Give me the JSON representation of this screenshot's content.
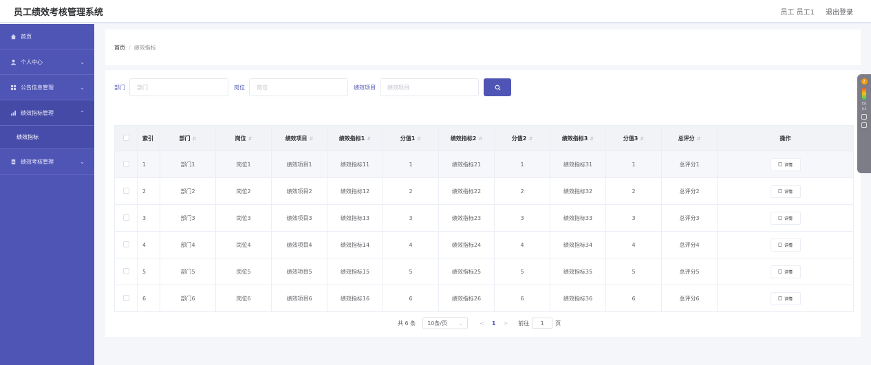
{
  "header": {
    "title": "员工绩效考核管理系统",
    "user": "员工 员工1",
    "logout": "退出登录"
  },
  "sidebar": {
    "items": [
      {
        "label": "首页",
        "icon": "home-icon"
      },
      {
        "label": "个人中心",
        "icon": "user-icon"
      },
      {
        "label": "公告信息管理",
        "icon": "grid-icon"
      },
      {
        "label": "绩效指标管理",
        "icon": "chart-icon",
        "expanded": true,
        "children": [
          {
            "label": "绩效指标"
          }
        ]
      },
      {
        "label": "绩效考核管理",
        "icon": "document-icon"
      }
    ]
  },
  "breadcrumb": {
    "home": "首页",
    "separator": "/",
    "current": "绩效指标"
  },
  "search": {
    "dept_label": "部门",
    "dept_placeholder": "部门",
    "post_label": "岗位",
    "post_placeholder": "岗位",
    "project_label": "绩效项目",
    "project_placeholder": "绩效项目"
  },
  "table": {
    "headers": [
      "索引",
      "部门",
      "岗位",
      "绩效项目",
      "绩效指标1",
      "分值1",
      "绩效指标2",
      "分值2",
      "绩效指标3",
      "分值3",
      "总评分",
      "操作"
    ],
    "detail_label": "详情",
    "rows": [
      [
        "1",
        "部门1",
        "岗位1",
        "绩效项目1",
        "绩效指标11",
        "1",
        "绩效指标21",
        "1",
        "绩效指标31",
        "1",
        "总评分1"
      ],
      [
        "2",
        "部门2",
        "岗位2",
        "绩效项目2",
        "绩效指标12",
        "2",
        "绩效指标22",
        "2",
        "绩效指标32",
        "2",
        "总评分2"
      ],
      [
        "3",
        "部门3",
        "岗位3",
        "绩效项目3",
        "绩效指标13",
        "3",
        "绩效指标23",
        "3",
        "绩效指标33",
        "3",
        "总评分3"
      ],
      [
        "4",
        "部门4",
        "岗位4",
        "绩效项目4",
        "绩效指标14",
        "4",
        "绩效指标24",
        "4",
        "绩效指标34",
        "4",
        "总评分4"
      ],
      [
        "5",
        "部门5",
        "岗位5",
        "绩效项目5",
        "绩效指标15",
        "5",
        "绩效指标25",
        "5",
        "绩效指标35",
        "5",
        "总评分5"
      ],
      [
        "6",
        "部门6",
        "岗位6",
        "绩效项目6",
        "绩效指标16",
        "6",
        "绩效指标26",
        "6",
        "绩效指标36",
        "6",
        "总评分6"
      ]
    ]
  },
  "pagination": {
    "total": "共 6 条",
    "page_size": "10条/页",
    "current_page": "1",
    "goto_label": "前往",
    "goto_value": "1",
    "page_suffix": "页"
  },
  "float_widget": {
    "badge": "2",
    "line1": "151",
    "line2": "9.5"
  },
  "colors": {
    "primary": "#4f55b5",
    "sidebar": "#4f55b5"
  }
}
